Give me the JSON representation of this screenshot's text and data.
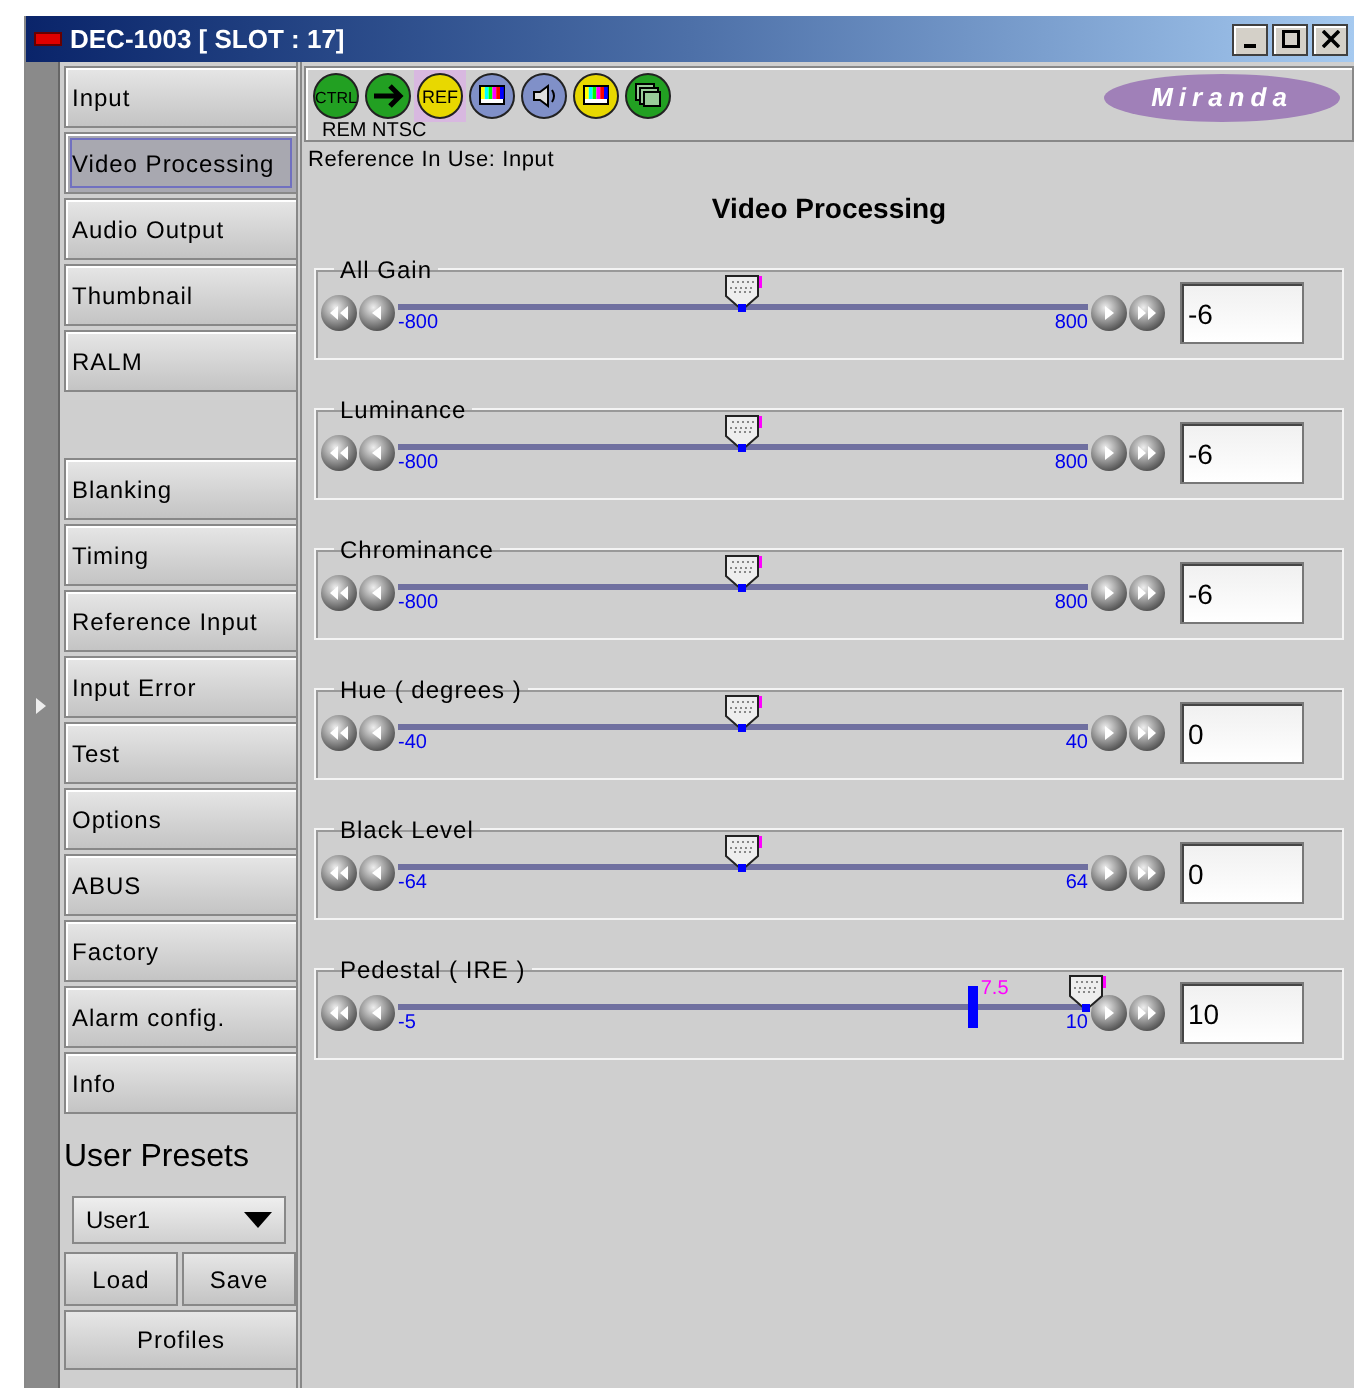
{
  "window": {
    "title": "DEC-1003 [ SLOT : 17]"
  },
  "sidebar": {
    "groups": [
      [
        {
          "label": "Input",
          "selected": false
        },
        {
          "label": "Video Processing",
          "selected": true
        },
        {
          "label": "Audio Output",
          "selected": false
        },
        {
          "label": "Thumbnail",
          "selected": false
        },
        {
          "label": "RALM",
          "selected": false
        }
      ],
      [
        {
          "label": "Blanking",
          "selected": false
        },
        {
          "label": "Timing",
          "selected": false
        },
        {
          "label": "Reference Input",
          "selected": false
        },
        {
          "label": "Input Error",
          "selected": false
        },
        {
          "label": "Test",
          "selected": false
        },
        {
          "label": "Options",
          "selected": false
        },
        {
          "label": "ABUS",
          "selected": false
        },
        {
          "label": "Factory",
          "selected": false
        },
        {
          "label": "Alarm config.",
          "selected": false
        },
        {
          "label": "Info",
          "selected": false
        }
      ]
    ],
    "user_presets": {
      "title": "User Presets",
      "preset": "User1",
      "buttons": [
        "Load",
        "Save"
      ],
      "profiles": "Profiles"
    }
  },
  "toolbar": {
    "icons": [
      {
        "kind": "ctrl",
        "label": "CTRL",
        "color": "#22a022"
      },
      {
        "kind": "arrow",
        "color": "#22a022"
      },
      {
        "kind": "ref",
        "label": "REF",
        "color": "#e8d800",
        "selected": true
      },
      {
        "kind": "bars",
        "color": "#8090c8"
      },
      {
        "kind": "speaker",
        "color": "#8090c8"
      },
      {
        "kind": "bars",
        "color": "#e8d800"
      },
      {
        "kind": "windows",
        "color": "#22a022"
      }
    ],
    "status": "REM NTSC",
    "logo": "Miranda"
  },
  "reference_in_use": "Reference In Use: Input",
  "heading": "Video Processing",
  "sliders": [
    {
      "label": "All Gain",
      "min": "-800",
      "max": "800",
      "level": 0.5,
      "value": "-6"
    },
    {
      "label": "Luminance",
      "min": "-800",
      "max": "800",
      "level": 0.5,
      "value": "-6"
    },
    {
      "label": "Chrominance",
      "min": "-800",
      "max": "800",
      "level": 0.5,
      "value": "-6"
    },
    {
      "label": "Hue ( degrees )",
      "min": "-40",
      "max": "40",
      "level": 0.5,
      "value": "0"
    },
    {
      "label": "Black Level",
      "min": "-64",
      "max": "64",
      "level": 0.5,
      "value": "0"
    },
    {
      "label": "Pedestal ( IRE )",
      "min": "-5",
      "max": "10",
      "level": 1,
      "value": "10",
      "reference": {
        "label": "7.5",
        "level": 0.833
      }
    }
  ]
}
